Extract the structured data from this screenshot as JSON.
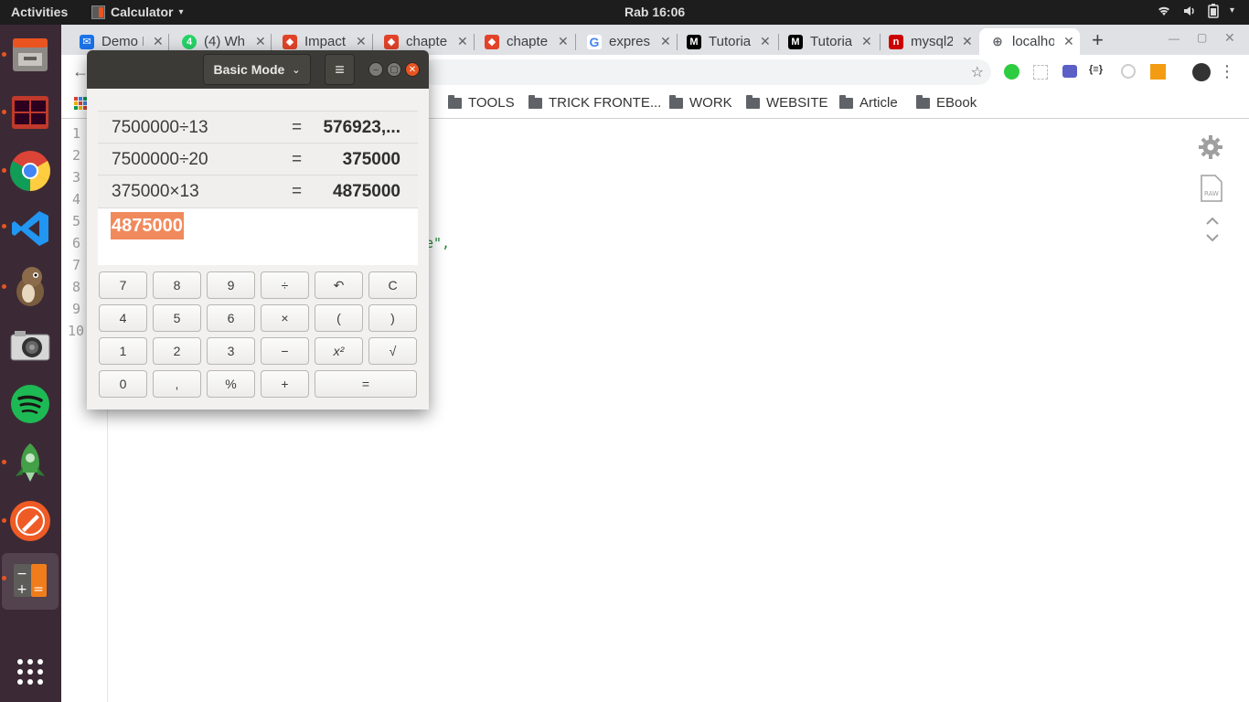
{
  "topbar": {
    "activities": "Activities",
    "app_name": "Calculator",
    "clock": "Rab 16:06",
    "tray_icons": [
      "wifi-icon",
      "volume-icon",
      "battery-icon",
      "power-dropdown-icon"
    ]
  },
  "dock": {
    "apps": [
      "files",
      "terminal",
      "chrome",
      "vscode",
      "dbeaver",
      "camera",
      "spotify",
      "app-launcher-rocket",
      "postman",
      "calculator"
    ],
    "active_app": "calculator",
    "show_apps_icon": "grid-icon"
  },
  "browser": {
    "tabs": [
      {
        "label": "Demo I",
        "fav_color": "#1a73e8"
      },
      {
        "label": "(4) Wh",
        "fav_color": "#25d366"
      },
      {
        "label": "Impact",
        "fav_color": "#e24329"
      },
      {
        "label": "chapte",
        "fav_color": "#e24329"
      },
      {
        "label": "chapte",
        "fav_color": "#e24329"
      },
      {
        "label": "expres",
        "fav_color": "#4285f4"
      },
      {
        "label": "Tutoria",
        "fav_color": "#000000"
      },
      {
        "label": "Tutoria",
        "fav_color": "#000000"
      },
      {
        "label": "mysql2",
        "fav_color": "#cc0000"
      },
      {
        "label": "localho",
        "fav_color": "#5f6368"
      }
    ],
    "new_tab": "+",
    "bookmarks": [
      "TOOLS",
      "TRICK FRONTE...",
      "WORK",
      "WEBSITE",
      "Article",
      "EBook"
    ]
  },
  "editor": {
    "line_numbers": [
      "1",
      "2",
      "3",
      "4",
      "5",
      "6",
      "7",
      "8",
      "9",
      "10"
    ],
    "visible_fragment": "e\","
  },
  "calculator": {
    "mode": "Basic Mode",
    "menu_icon": "≡",
    "history": [
      {
        "expr": "7500000÷13",
        "eq": "=",
        "result": "576923,..."
      },
      {
        "expr": "7500000÷20",
        "eq": "=",
        "result": "375000"
      },
      {
        "expr": "375000×13",
        "eq": "=",
        "result": "4875000"
      }
    ],
    "display": "4875000",
    "keys": {
      "r1": [
        "7",
        "8",
        "9",
        "÷",
        "↶",
        "C"
      ],
      "r2": [
        "4",
        "5",
        "6",
        "×",
        "(",
        ")"
      ],
      "r3": [
        "1",
        "2",
        "3",
        "−",
        "x²",
        "√"
      ],
      "r4": [
        "0",
        ",",
        "%",
        "+",
        "="
      ]
    }
  }
}
